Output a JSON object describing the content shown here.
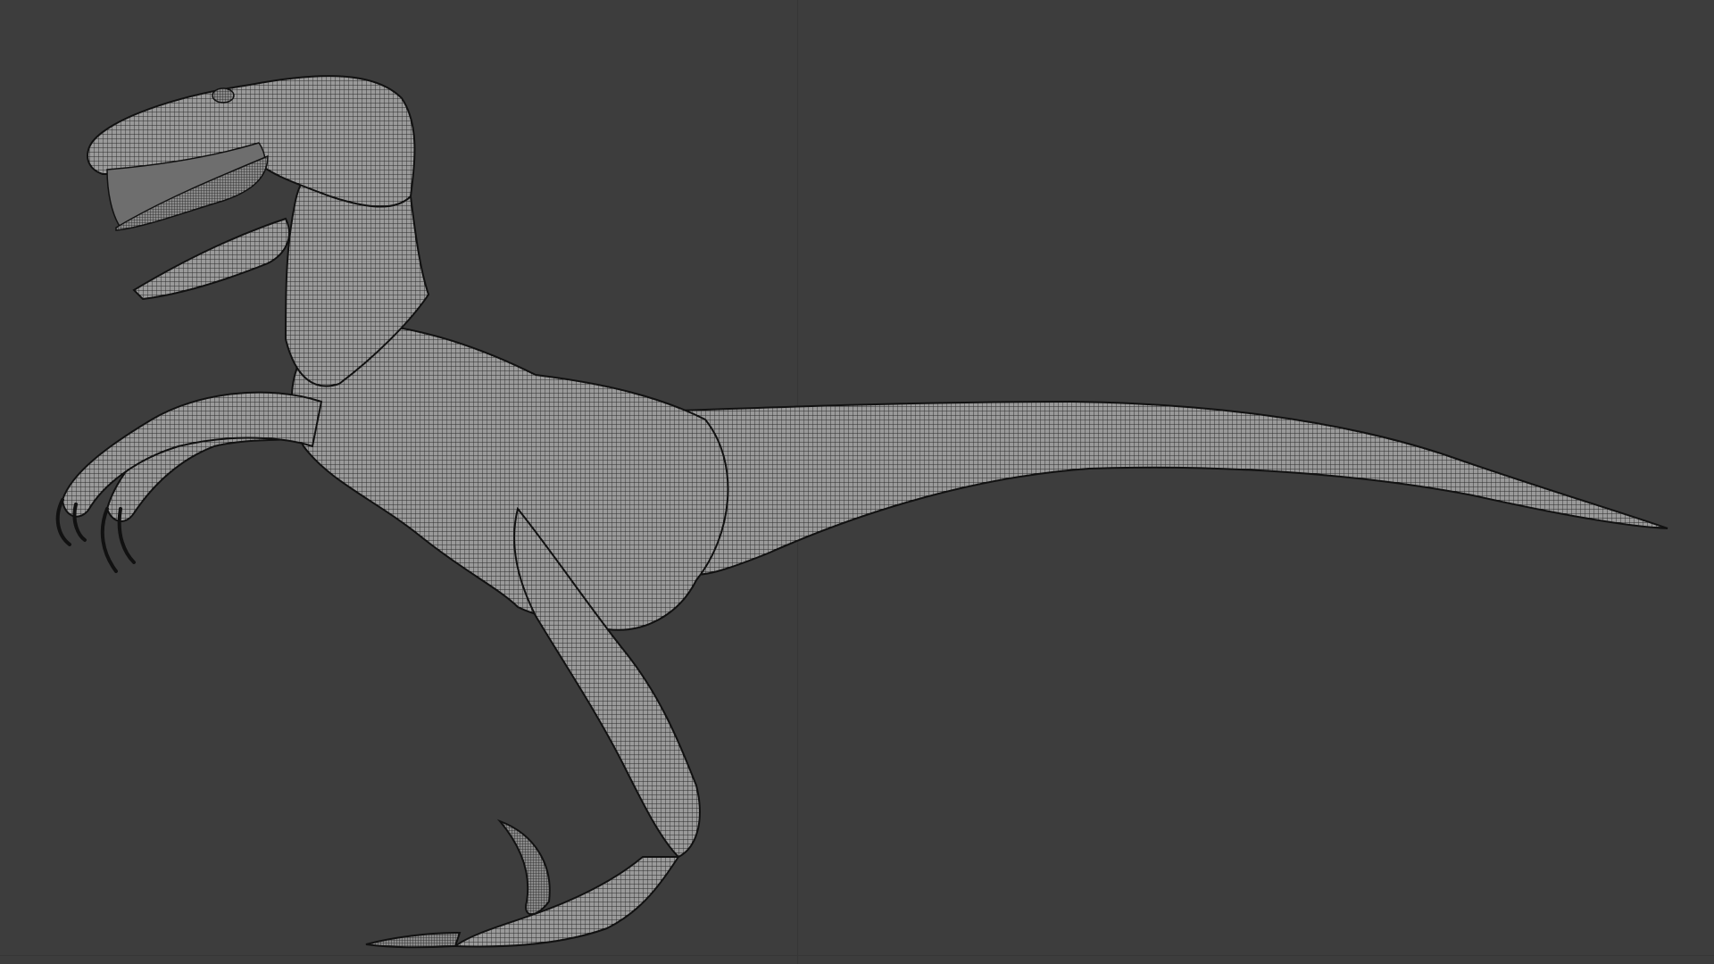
{
  "viewport": {
    "background_color": "#3d3d3d",
    "grid_color": "#363636",
    "mesh_fill_color": "#8f8f8f",
    "wire_color": "#1c1c1c",
    "shading_mode": "wireframe-overlay"
  },
  "model": {
    "subject": "raptor",
    "view": "side"
  }
}
